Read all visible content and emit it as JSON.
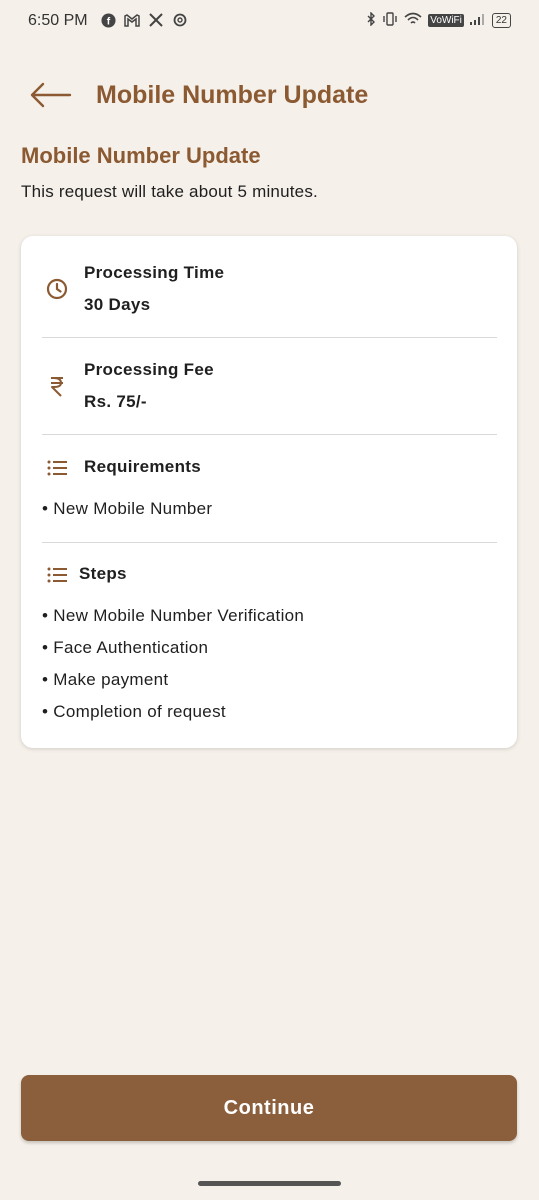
{
  "status_bar": {
    "time": "6:50 PM",
    "left_icons": [
      "facebook-icon",
      "gmail-icon",
      "x-icon",
      "threads-icon"
    ],
    "volte": "VoWiFi",
    "battery": "22"
  },
  "header": {
    "title": "Mobile Number Update"
  },
  "intro": {
    "title": "Mobile Number Update",
    "subtitle": "This request will take about 5 minutes."
  },
  "card": {
    "processing_time": {
      "label": "Processing Time",
      "value": "30 Days"
    },
    "processing_fee": {
      "label": "Processing Fee",
      "value": "Rs. 75/-"
    },
    "requirements": {
      "label": "Requirements",
      "items": [
        "• New Mobile Number"
      ]
    },
    "steps": {
      "label": "Steps",
      "items": [
        "• New Mobile Number Verification",
        "• Face Authentication",
        "• Make payment",
        "• Completion of request"
      ]
    }
  },
  "footer": {
    "continue_label": "Continue"
  },
  "colors": {
    "accent": "#8b5a32",
    "button": "#8b5e3c",
    "background": "#f5f0e9"
  }
}
